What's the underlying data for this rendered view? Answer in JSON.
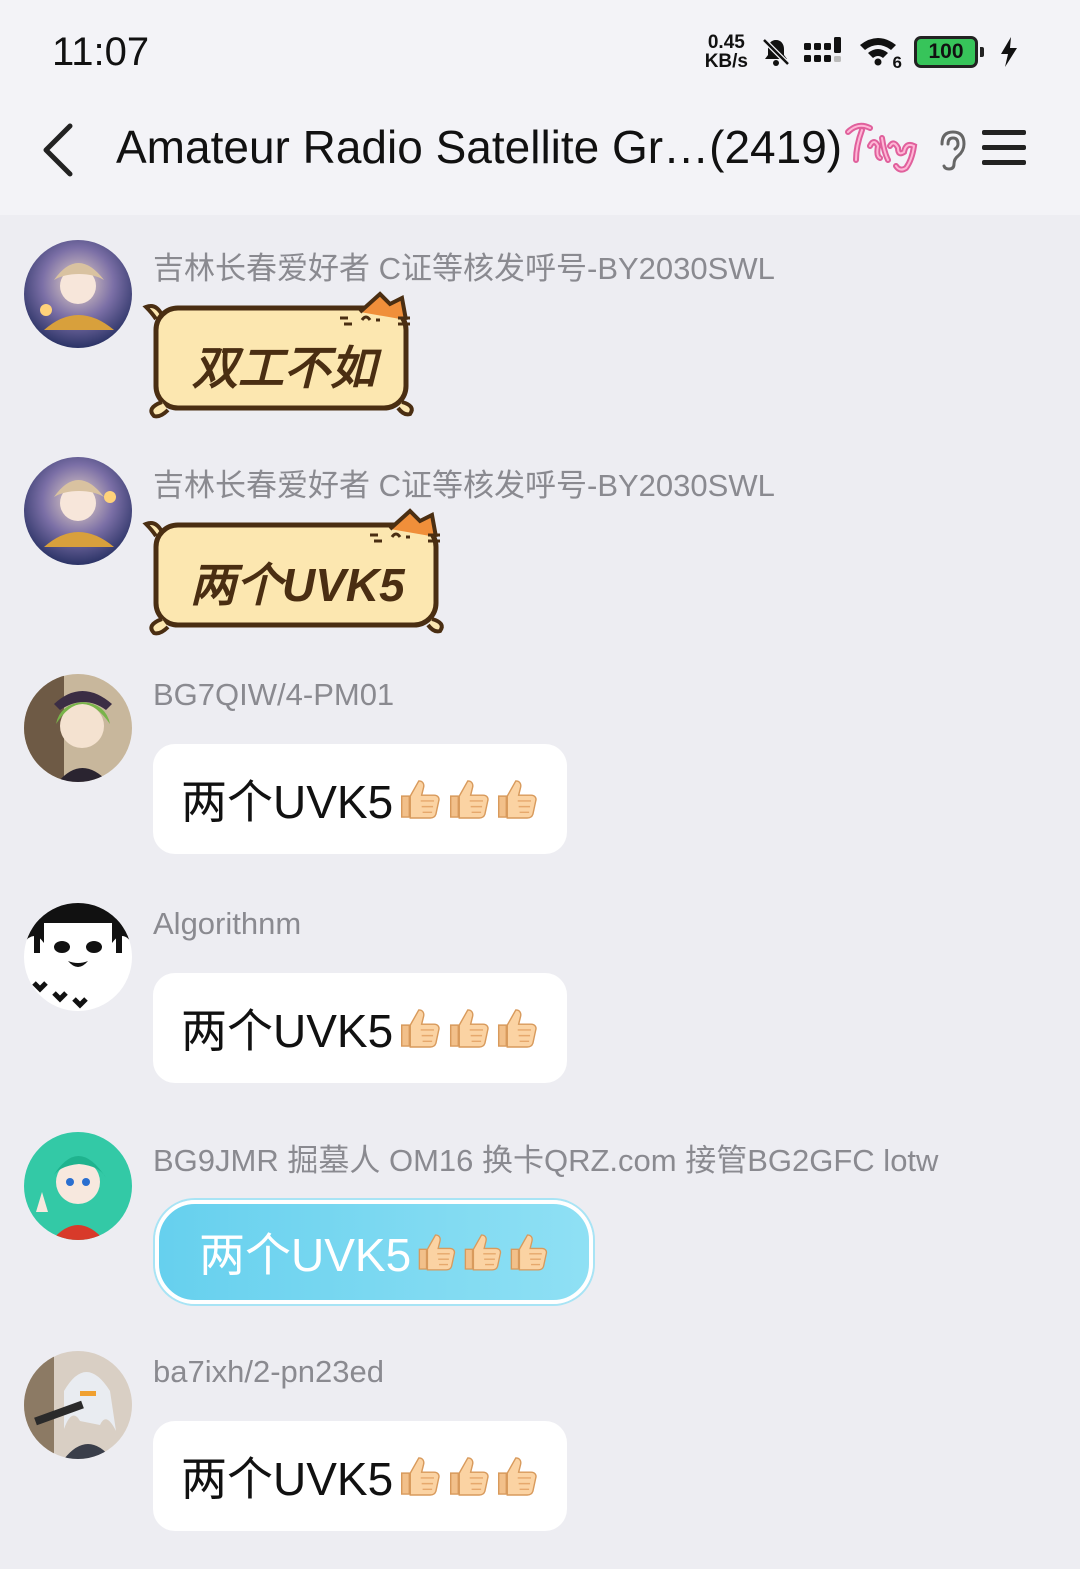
{
  "status_bar": {
    "time": "11:07",
    "speed_value": "0.45",
    "speed_unit": "KB/s",
    "wifi_label": "6",
    "battery": "100"
  },
  "header": {
    "title": "Amateur Radio Satellite Gr…(2419)"
  },
  "colors": {
    "background": "#ededf2",
    "bubble_blue": "#66d0ee",
    "battery_green": "#37c45a"
  },
  "messages": [
    {
      "sender": "吉林长春爱好者 C证等核发呼号-BY2030SWL",
      "text": "双工不如",
      "style": "cat-sticker-bubble"
    },
    {
      "sender": "吉林长春爱好者 C证等核发呼号-BY2030SWL",
      "text": "两个UVK5",
      "style": "cat-sticker-bubble"
    },
    {
      "sender": "BG7QIW/4-PM01",
      "text": "两个UVK5",
      "icons": [
        "thumbs-up-icon",
        "thumbs-up-icon",
        "thumbs-up-icon"
      ]
    },
    {
      "sender": "Algorithnm",
      "text": "两个UVK5",
      "icons": [
        "thumbs-up-icon",
        "thumbs-up-icon",
        "thumbs-up-icon"
      ]
    },
    {
      "sender": "BG9JMR 掘墓人 OM16 换卡QRZ.com 接管BG2GFC lotw",
      "text": "两个UVK5",
      "style": "blue-bubble",
      "icons": [
        "thumbs-up-icon",
        "thumbs-up-icon",
        "thumbs-up-icon"
      ]
    },
    {
      "sender": "ba7ixh/2-pn23ed",
      "text": "两个UVK5",
      "icons": [
        "thumbs-up-icon",
        "thumbs-up-icon",
        "thumbs-up-icon"
      ]
    }
  ]
}
